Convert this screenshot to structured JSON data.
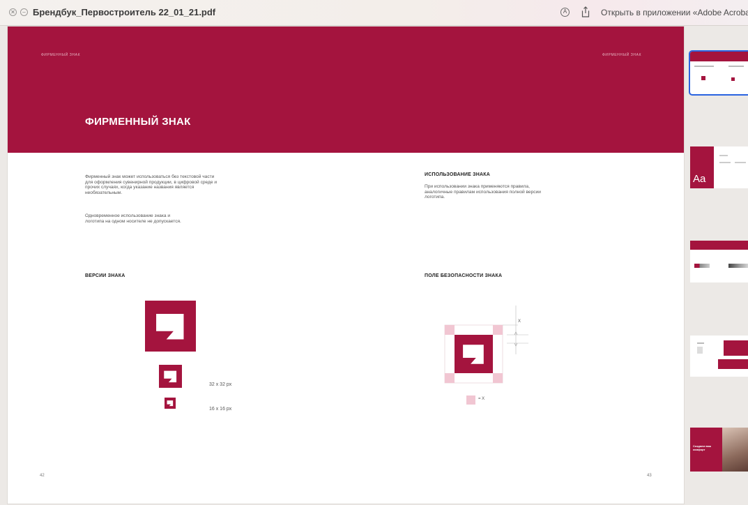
{
  "window": {
    "title": "Брендбук_Первостроитель 22_01_21.pdf",
    "open_in_app": "Открыть в приложении «Adobe Acrobat»"
  },
  "colors": {
    "brand": "#a4143e",
    "safe_zone": "#f1c6d2",
    "thumb_selected": "#2a63e0"
  },
  "icons": [
    "close-icon",
    "minimize-icon",
    "annotate-icon",
    "share-icon"
  ],
  "spread": {
    "banner_label_left": "ФИРМЕННЫЙ ЗНАК",
    "banner_label_right": "ФИРМЕННЫЙ ЗНАК",
    "banner_title": "ФИРМЕННЫЙ ЗНАК",
    "left": {
      "paragraph1": "Фирменный знак может использоваться без текстовой части для оформления сувенирной продукции, в цифровой среде и прочих случаях, когда указание названия является необязательным.",
      "paragraph2": "Одновременное использование знака и логотипа на одном носителе не допускается.",
      "versions_heading": "ВЕРСИИ ЗНАКА",
      "size_32": "32 x 32 px",
      "size_16": "16 x 16 px",
      "page_number": "42"
    },
    "right": {
      "usage_heading": "ИСПОЛЬЗОВАНИЕ ЗНАКА",
      "usage_text": "При использовании знака применяются правила, аналогичные правилам использования полной версии логотипа.",
      "safety_heading": "ПОЛЕ БЕЗОПАСНОСТИ ЗНАКА",
      "x_label": "X",
      "legend_label": "= X",
      "page_number": "43"
    }
  },
  "thumbnails": {
    "typography_label": "Aa",
    "promo_text": "Создаем ваш комфорт"
  }
}
